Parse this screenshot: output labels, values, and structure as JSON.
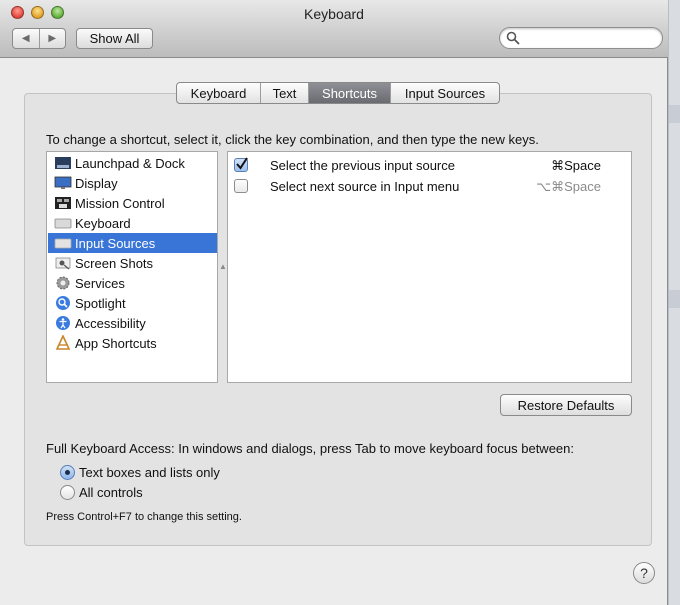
{
  "window": {
    "title": "Keyboard"
  },
  "toolbar": {
    "show_all": "Show All",
    "back": "◀",
    "forward": "▶",
    "search_placeholder": ""
  },
  "tabs": [
    {
      "label": "Keyboard",
      "active": false
    },
    {
      "label": "Text",
      "active": false
    },
    {
      "label": "Shortcuts",
      "active": true
    },
    {
      "label": "Input Sources",
      "active": false
    }
  ],
  "instructions": "To change a shortcut, select it, click the key combination, and then type the new keys.",
  "categories": [
    {
      "label": "Launchpad & Dock",
      "icon": "launchpad-icon",
      "selected": false
    },
    {
      "label": "Display",
      "icon": "display-icon",
      "selected": false
    },
    {
      "label": "Mission Control",
      "icon": "mission-control-icon",
      "selected": false
    },
    {
      "label": "Keyboard",
      "icon": "keyboard-icon",
      "selected": false
    },
    {
      "label": "Input Sources",
      "icon": "input-sources-icon",
      "selected": true
    },
    {
      "label": "Screen Shots",
      "icon": "screen-shots-icon",
      "selected": false
    },
    {
      "label": "Services",
      "icon": "gear-icon",
      "selected": false
    },
    {
      "label": "Spotlight",
      "icon": "spotlight-icon",
      "selected": false
    },
    {
      "label": "Accessibility",
      "icon": "accessibility-icon",
      "selected": false
    },
    {
      "label": "App Shortcuts",
      "icon": "app-shortcuts-icon",
      "selected": false
    }
  ],
  "shortcuts": [
    {
      "label": "Select the previous input source",
      "key": "⌘Space",
      "checked": true
    },
    {
      "label": "Select next source in Input menu",
      "key": "⌥⌘Space",
      "checked": false
    }
  ],
  "restore_defaults": "Restore Defaults",
  "full_keyboard_access": {
    "label": "Full Keyboard Access: In windows and dialogs, press Tab to move keyboard focus between:",
    "options": [
      {
        "label": "Text boxes and lists only",
        "selected": true
      },
      {
        "label": "All controls",
        "selected": false
      }
    ],
    "note": "Press Control+F7 to change this setting."
  },
  "help": "?",
  "colors": {
    "selection": "#3875d7",
    "active_tab": "#7b7c82"
  }
}
